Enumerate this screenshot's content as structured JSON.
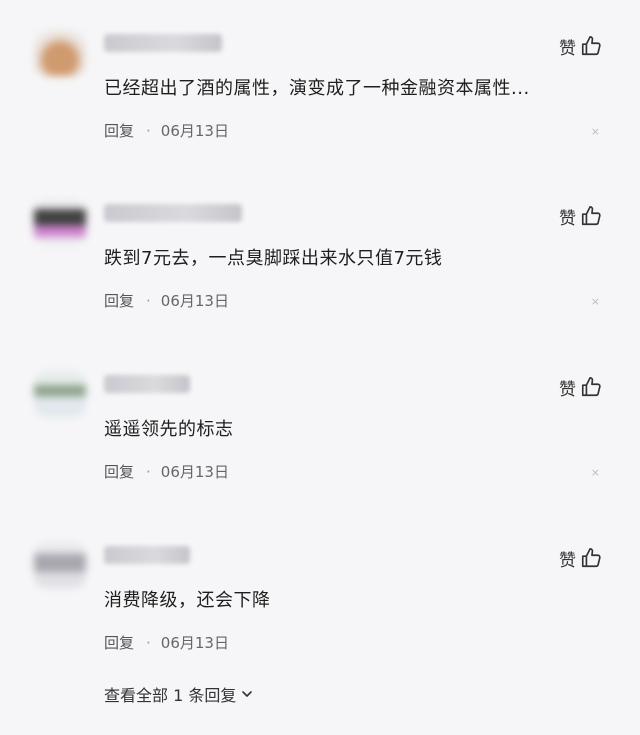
{
  "comments": [
    {
      "text": "已经超出了酒的属性，演变成了一种金融资本属性...",
      "like_label": "赞",
      "reply_label": "回复",
      "separator": "·",
      "date": "06月13日",
      "close_glyph": "×"
    },
    {
      "text": "跌到7元去，一点臭脚踩出来水只值7元钱",
      "like_label": "赞",
      "reply_label": "回复",
      "separator": "·",
      "date": "06月13日",
      "close_glyph": "×"
    },
    {
      "text": "遥遥领先的标志",
      "like_label": "赞",
      "reply_label": "回复",
      "separator": "·",
      "date": "06月13日",
      "close_glyph": "×"
    },
    {
      "text": "消费降级，还会下降",
      "like_label": "赞",
      "reply_label": "回复",
      "separator": "·",
      "date": "06月13日"
    }
  ],
  "view_all": {
    "label": "查看全部 1 条回复"
  },
  "icons": {
    "like": "thumbs-up-icon",
    "expand": "chevron-down-icon",
    "close": "close-icon"
  },
  "colors": {
    "background": "#f6f6f8",
    "text": "#1e1e1e",
    "meta": "#555555"
  }
}
